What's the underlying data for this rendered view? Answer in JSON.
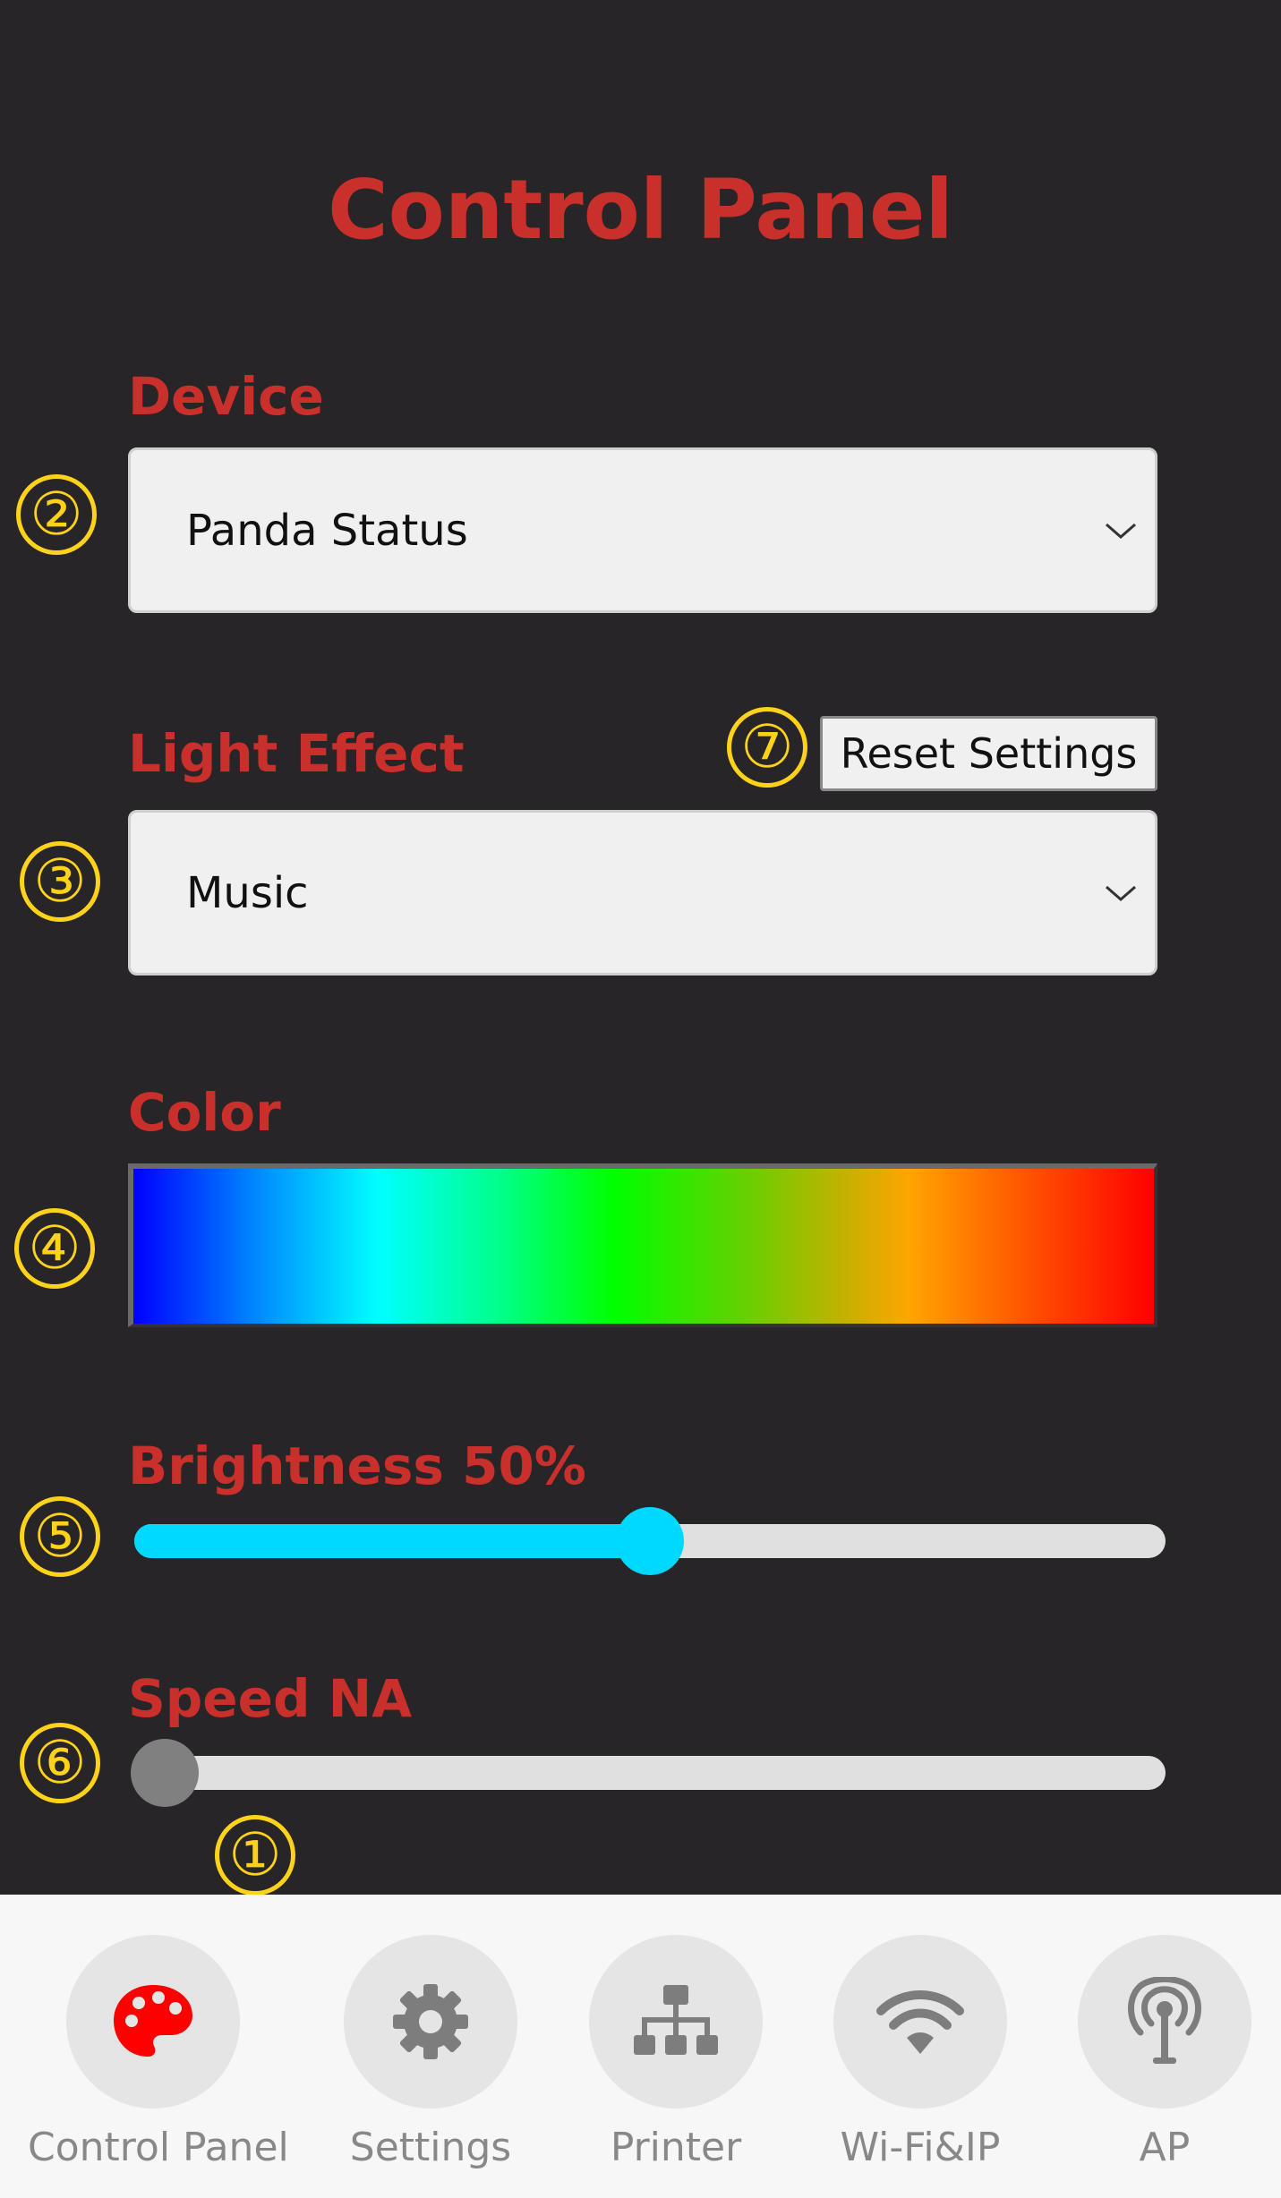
{
  "page": {
    "title": "Control Panel"
  },
  "device": {
    "label": "Device",
    "selected": "Panda Status"
  },
  "light_effect": {
    "label": "Light Effect",
    "selected": "Music",
    "reset_label": "Reset Settings"
  },
  "color": {
    "label": "Color",
    "gradient_stops": [
      "#0000ff",
      "#00ffff",
      "#00ff00",
      "#ffa500",
      "#ff0000"
    ]
  },
  "brightness": {
    "label": "Brightness 50%",
    "value": 0.5,
    "fill_color": "#00d9ff"
  },
  "speed": {
    "label": "Speed NA",
    "value": 0,
    "thumb_color": "#808080"
  },
  "markers": {
    "m1": "①",
    "m2": "②",
    "m3": "③",
    "m4": "④",
    "m5": "⑤",
    "m6": "⑥",
    "m7": "⑦"
  },
  "nav": {
    "items": [
      {
        "label": "Control Panel",
        "icon": "palette-icon",
        "active": true
      },
      {
        "label": "Settings",
        "icon": "gear-icon"
      },
      {
        "label": "Printer",
        "icon": "network-icon"
      },
      {
        "label": "Wi-Fi&IP",
        "icon": "wifi-icon"
      },
      {
        "label": "AP",
        "icon": "antenna-icon"
      }
    ]
  },
  "colors": {
    "accent": "#c9302c",
    "background": "#272527",
    "marker": "#ffd21a",
    "nav_active_icon": "#ff0000",
    "nav_icon": "#888888"
  }
}
